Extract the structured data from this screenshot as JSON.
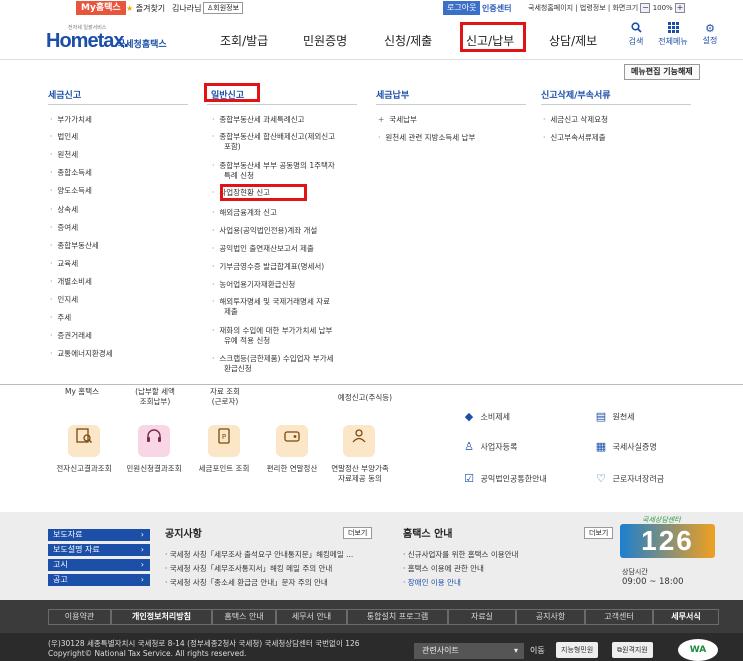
{
  "topbar": {
    "my_hometax": "My홈택스",
    "favorites": "즐겨찾기",
    "user_name": "김나라님",
    "user_info": "회원정보",
    "logout": "로그아웃",
    "cert_center": "인증센터",
    "links": "국세청홈페이지 | 법령정보 | 화면크기",
    "zoom_minus": "−",
    "zoom_value": "100%",
    "zoom_plus": "+"
  },
  "header": {
    "logo_text": "Hometax.",
    "logo_sub": "국세청홈택스",
    "logo_tiny": "전자세 일괄서비스",
    "menu": [
      "조회/발급",
      "민원증명",
      "신청/제출",
      "신고/납부",
      "상담/제보"
    ],
    "selected_menu": "신고/납부",
    "icons": [
      {
        "name": "search-icon",
        "glyph": "🔍",
        "label": "검색"
      },
      {
        "name": "all-menu-icon",
        "glyph": "⋮⋮⋮",
        "label": "전체메뉴"
      },
      {
        "name": "settings-icon",
        "glyph": "⚙",
        "label": "설정"
      }
    ]
  },
  "dropdown": {
    "menu_edit": "메뉴편집 기능해제",
    "columns": [
      {
        "title": "세금신고",
        "items": [
          "부가가치세",
          "법인세",
          "원천세",
          "종합소득세",
          "양도소득세",
          "상속세",
          "증여세",
          "종합부동산세",
          "교육세",
          "개별소비세",
          "인지세",
          "주세",
          "증권거래세",
          "교통에너지환경세"
        ]
      },
      {
        "title": "일반신고",
        "items": [
          "종합부동산세 과세특례신고",
          "종합부동산세 합산배제신고(제외신고\n포함)",
          "종합부동산세 부부 공동명의 1주택자\n특례 신청",
          "사업장현황 신고",
          "해외금융계좌 신고",
          "사업용(공익법인전용)계좌 개설",
          "공익법인 출연재산보고서 제출",
          "기부금영수증 발급합계표(명세서)",
          "농어업용기자재환급신청",
          "해외투자명세 및 국제거래명세 자료\n제출",
          "재화의 수입에 대한 부가가치세 납부\n유예 적용 신청",
          "스크랩등(금한제품) 수입업자 부가세\n환급신청"
        ],
        "selected_item": "사업장현황 신고"
      },
      {
        "title": "세금납부",
        "items": [
          "국세납부",
          "원천세 관련 지방소득세 납부"
        ]
      },
      {
        "title": "신고삭제/부속서류",
        "items": [
          "세금신고 삭제요청",
          "신고부속서류제출"
        ]
      }
    ]
  },
  "quick": {
    "partial_labels": [
      "My 홈택스",
      "(납부할 세액\n조회납부)",
      "자료 조회\n(근로자)",
      "예정신고(주식등)"
    ],
    "tiles": [
      {
        "label": "전자신고결과조회",
        "icon": "certificate-search-icon",
        "bg": "#fbe6c8"
      },
      {
        "label": "민원신청결과조회",
        "icon": "headset-icon",
        "bg": "#f8d6e6"
      },
      {
        "label": "세금포인트 조회",
        "icon": "point-card-icon",
        "bg": "#fbe6c8"
      },
      {
        "label": "편리한 연말정산",
        "icon": "wallet-icon",
        "bg": "#fbe6c8"
      },
      {
        "label": "연말정산 부양가족\n자료제공 동의",
        "icon": "family-icon",
        "bg": "#fbe6c8"
      }
    ],
    "services": [
      {
        "label": "소비제세",
        "icon": "diamond-icon"
      },
      {
        "label": "원천세",
        "icon": "document-icon"
      },
      {
        "label": "사업자등록",
        "icon": "person-icon"
      },
      {
        "label": "국세사실증명",
        "icon": "certificate-icon"
      },
      {
        "label": "공익법인공통한안내",
        "icon": "checklist-icon"
      },
      {
        "label": "근로자녀장려금",
        "icon": "heart-icon"
      }
    ]
  },
  "news": {
    "side_menu": [
      "보도자료",
      "보도설명 자료",
      "고시",
      "공고"
    ],
    "notice_title": "공지사항",
    "notice_more": "더보기",
    "notices": [
      "국세청 사칭「세무조사 출석요구 안내통지문」해킹메일 ...",
      "국세청 사칭「세무조사통지서」해킹 메일 주의 안내",
      "국세청 사칭「종소세 환급금 안내」문자 주의 안내"
    ],
    "guide_title": "홈택스 안내",
    "guide_more": "더보기",
    "guides": [
      "신규사업자를 위한 홈택스 이용안내",
      "홈택스 이용에 관한 안내",
      "장애인 이용 안내"
    ],
    "center_title": "국세상담센터",
    "center_number": "126",
    "center_hours_label": "상담시간",
    "center_hours": "09:00 ~ 18:00"
  },
  "footer": {
    "nav": [
      "이용약관",
      "개인정보처리방침",
      "홈택스 안내",
      "세무서 안내",
      "통합설치 프로그램",
      "자료실",
      "공지사항",
      "고객센터",
      "세무서식"
    ],
    "address_line1": "(우)30128 세종특별자치시 국세청로 8-14 (정부세종2청사 국세청) 국세청상담센터 국번없이 126",
    "address_line2": "Copyright© National Tax Service. All rights reserved.",
    "related_sites": "관련사이트",
    "go_label": "이동",
    "btn_chatbot": "지능형민원",
    "btn_remote": "원격지원",
    "wa_mark": "WA"
  }
}
